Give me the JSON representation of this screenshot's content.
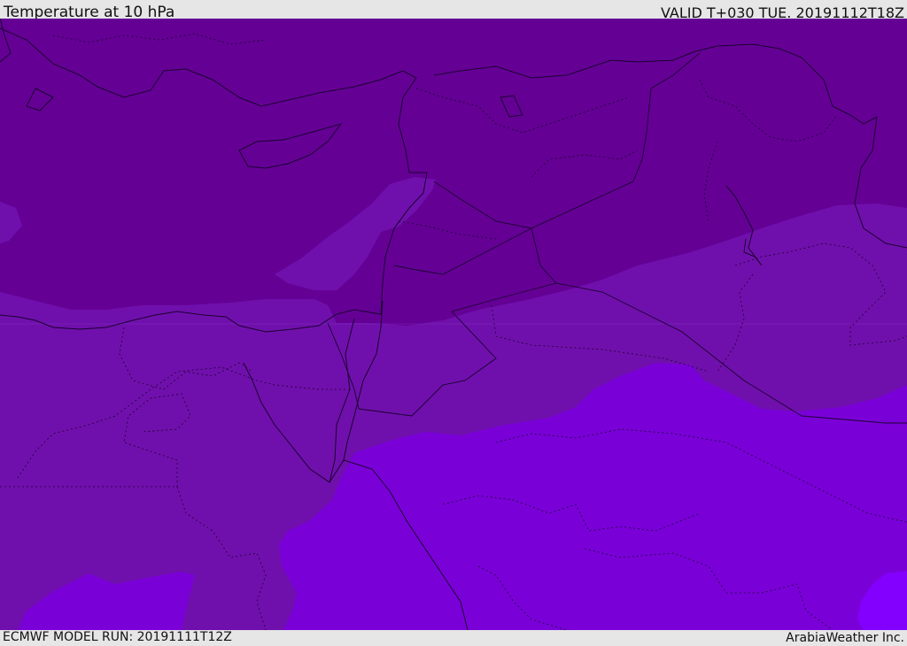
{
  "header": {
    "title": "Temperature at 10 hPa",
    "valid": "VALID T+030 TUE. 20191112T18Z"
  },
  "footer": {
    "model_run": "ECMWF MODEL RUN: 20191111T12Z",
    "brand": "ArabiaWeather Inc."
  },
  "map": {
    "colors": {
      "band_darkest": "#650095",
      "band_dark": "#7010ac",
      "band_mid": "#7a00d8",
      "band_bright": "#8300ff",
      "coast": "#1a0030"
    }
  }
}
